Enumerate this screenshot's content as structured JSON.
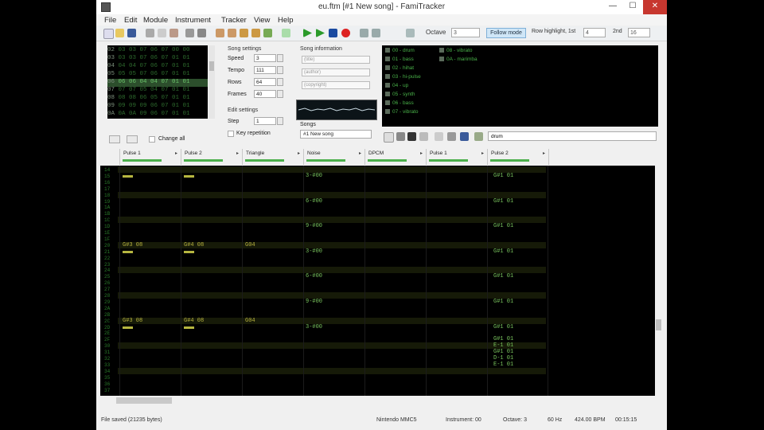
{
  "window": {
    "title": "eu.ftm [#1 New song] - FamiTracker",
    "min": "—",
    "max": "☐",
    "close": "✕"
  },
  "menu": [
    "File",
    "Edit",
    "Module",
    "Instrument",
    "Tracker",
    "View",
    "Help"
  ],
  "toolbar": {
    "octave_label": "Octave",
    "octave_value": "3",
    "follow_mode": "Follow mode",
    "row_highlight_label": "Row highlight, 1st",
    "row_highlight_1": "4",
    "row_highlight_2_label": "2nd",
    "row_highlight_2": "16"
  },
  "frames": {
    "rows": [
      {
        "n": "02",
        "cells": "03 03 07 06 07 00 00"
      },
      {
        "n": "03",
        "cells": "03 03 07 06 07 01 01"
      },
      {
        "n": "04",
        "cells": "04 04 07 06 07 01 01"
      },
      {
        "n": "05",
        "cells": "05 05 07 06 07 01 01"
      },
      {
        "n": "06",
        "cells": "06 06 04 04 07 01 01"
      },
      {
        "n": "07",
        "cells": "07 07 05 04 07 01 01"
      },
      {
        "n": "08",
        "cells": "08 08 06 05 07 01 01"
      },
      {
        "n": "09",
        "cells": "09 09 09 06 07 01 01"
      },
      {
        "n": "0A",
        "cells": "0A 0A 09 06 07 01 01"
      }
    ],
    "current_index": 4,
    "change_all": "Change all"
  },
  "song_settings": {
    "title": "Song settings",
    "speed_label": "Speed",
    "speed": "3",
    "tempo_label": "Tempo",
    "tempo": "111",
    "rows_label": "Rows",
    "rows": "64",
    "frames_label": "Frames",
    "frames": "40"
  },
  "edit_settings": {
    "title": "Edit settings",
    "step_label": "Step",
    "step": "1",
    "key_repetition": "Key repetition"
  },
  "song_info": {
    "title": "Song information",
    "name": "(title)",
    "author": "(author)",
    "copyright": "(copyright)"
  },
  "songs": {
    "label": "Songs",
    "selected": "#1 New song"
  },
  "instruments": [
    {
      "text": "00 - drum"
    },
    {
      "text": "01 - bass"
    },
    {
      "text": "02 - hihat"
    },
    {
      "text": "03 - hi-pulse"
    },
    {
      "text": "04 - up"
    },
    {
      "text": "05 - synth"
    },
    {
      "text": "06 - bass"
    },
    {
      "text": "07 - vibrato"
    },
    {
      "text": "08 - vibrato"
    },
    {
      "text": "0A - marimba"
    }
  ],
  "instrument_name": "drum",
  "channels": [
    {
      "name": "Pulse 1",
      "arrow": "▸",
      "vol": 70
    },
    {
      "name": "Pulse 2",
      "arrow": "▸",
      "vol": 70
    },
    {
      "name": "Triangle",
      "arrow": "▸",
      "vol": 70
    },
    {
      "name": "Noise",
      "arrow": "▸",
      "vol": 70
    },
    {
      "name": "DPCM",
      "arrow": "▸",
      "vol": 70
    },
    {
      "name": "Pulse 1",
      "arrow": "▸",
      "vol": 70
    },
    {
      "name": "Pulse 2",
      "arrow": "▸",
      "vol": 70
    }
  ],
  "pattern": {
    "row_numbers": [
      "14",
      "15",
      "16",
      "17",
      "18",
      "19",
      "1A",
      "1B",
      "1C",
      "1D",
      "1E",
      "1F",
      "20",
      "21",
      "22",
      "23",
      "24",
      "25",
      "26",
      "27",
      "28",
      "29",
      "2A",
      "2B",
      "2C",
      "2D",
      "2E",
      "2F",
      "30",
      "31",
      "32",
      "33",
      "34",
      "35",
      "36",
      "37"
    ],
    "cells": {
      "noise_15": "3-#00",
      "noise_19": "6-#00",
      "noise_1D": "9-#00",
      "noise_21": "3-#00",
      "noise_25": "6-#00",
      "noise_29": "9-#00",
      "noise_2D": "3-#00",
      "p2b_15": "G#1 01",
      "p2b_19": "G#1 01",
      "p2b_1D": "G#1 01",
      "p2b_21": "G#1 01",
      "p2b_25": "G#1 01",
      "p2b_29": "G#1 01",
      "p2b_2D": "G#1 01",
      "p2b_31": "G#1 01",
      "p1_20": "G#3 08",
      "p2_20": "G#4 08",
      "tri_20": "G04",
      "p1_2C": "G#3 08",
      "p2_2C": "G#4 08",
      "tri_2C": "G04",
      "p2b_2F": "G#1 01",
      "p2b_30": "E-1 01",
      "p2b_32": "D-1 01",
      "p2b_33": "E-1 01"
    }
  },
  "status": {
    "left": "File saved (21235 bytes)",
    "chip": "Nintendo MMC5",
    "instrument": "Instrument: 00",
    "octave": "Octave: 3",
    "rate": "60 Hz",
    "bpm": "424.00 BPM",
    "time": "00:15:15"
  }
}
